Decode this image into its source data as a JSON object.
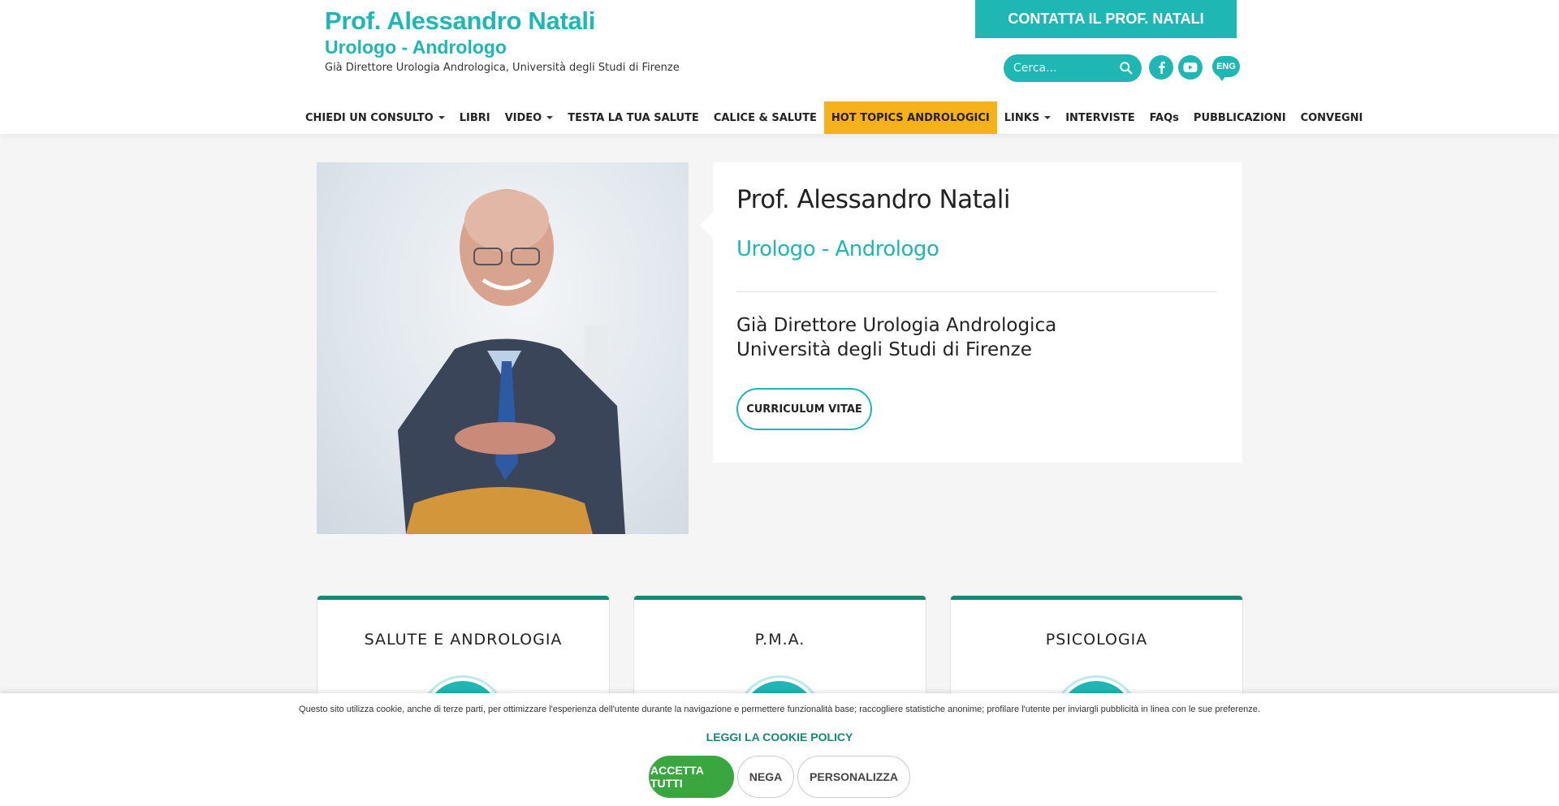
{
  "header": {
    "brand_name": "Prof. Alessandro Natali",
    "brand_subtitle": "Urologo - Andrologo",
    "brand_description": "Già Direttore Urologia Andrologica, Università degli Studi di Firenze",
    "contact_button": "CONTATTA IL PROF. NATALI",
    "search_placeholder": "Cerca...",
    "language_toggle": "ENG",
    "social": [
      "facebook-icon",
      "youtube-icon"
    ],
    "accent_color": "#1fb7b4",
    "highlight_color": "#f7b11a"
  },
  "nav": {
    "items": [
      {
        "label": "CHIEDI UN CONSULTO",
        "dropdown": true
      },
      {
        "label": "LIBRI",
        "dropdown": false
      },
      {
        "label": "VIDEO",
        "dropdown": true
      },
      {
        "label": "TESTA LA TUA SALUTE",
        "dropdown": false
      },
      {
        "label": "CALICE & SALUTE",
        "dropdown": false
      },
      {
        "label": "HOT TOPICS ANDROLOGICI",
        "dropdown": false,
        "highlighted": true
      },
      {
        "label": "LINKS",
        "dropdown": true
      },
      {
        "label": "INTERVISTE",
        "dropdown": false
      },
      {
        "label": "FAQs",
        "dropdown": false
      },
      {
        "label": "PUBBLICAZIONI",
        "dropdown": false
      },
      {
        "label": "CONVEGNI",
        "dropdown": false
      }
    ]
  },
  "profile": {
    "name": "Prof. Alessandro Natali",
    "role": "Urologo - Andrologo",
    "description_line1": "Già Direttore Urologia Andrologica",
    "description_line2": "Università degli Studi di Firenze",
    "cv_button": "CURRICULUM VITAE"
  },
  "categories": [
    {
      "title": "SALUTE E ANDROLOGIA"
    },
    {
      "title": "P.M.A."
    },
    {
      "title": "PSICOLOGIA"
    }
  ],
  "cookie": {
    "text": "Questo sito utilizza cookie, anche di terze parti, per ottimizzare l'esperienza dell'utente durante la navigazione e permettere funzionalità base; raccogliere statistiche anonime; profilare l'utente per inviargli pubblicità in linea con le sue preferenze.",
    "policy_link": "LEGGI LA COOKIE POLICY",
    "accept": "ACCETTA TUTTI",
    "deny": "NEGA",
    "customize": "PERSONALIZZA"
  }
}
